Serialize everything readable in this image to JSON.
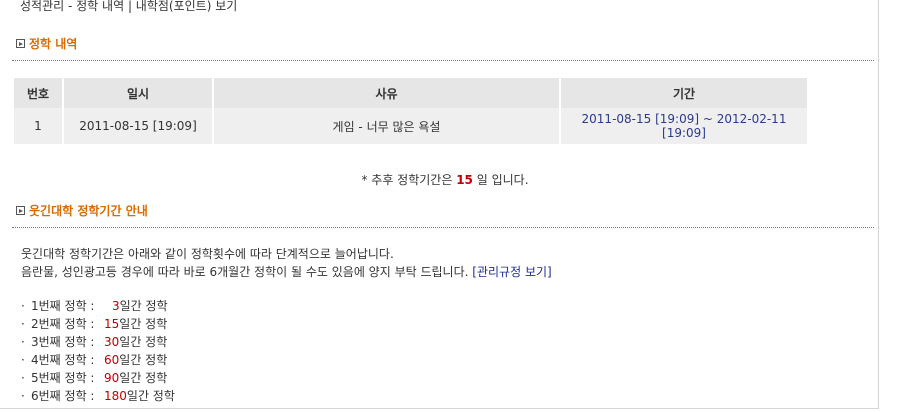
{
  "breadcrumb": {
    "section": "성적관리",
    "sep1": " - ",
    "current": "정학 내역",
    "sep2": " | ",
    "link": "내학점(포인트) 보기"
  },
  "history": {
    "title": "정학 내역",
    "columns": [
      "번호",
      "일시",
      "사유",
      "기간"
    ],
    "rows": [
      {
        "no": "1",
        "date": "2011-08-15 [19:09]",
        "reason": "게임 - 너무 많은 욕설",
        "period": "2011-08-15 [19:09] ~ 2012-02-11 [19:09]"
      }
    ],
    "note_prefix": "* 추후 정학기간은 ",
    "note_value": "15",
    "note_suffix": " 일 입니다."
  },
  "policy": {
    "title": "웃긴대학 정학기간 안내",
    "line1": "웃긴대학 정학기간은 아래와 같이 정학횟수에 따라 단계적으로 늘어납니다.",
    "line2": "음란물, 성인광고등 경우에 따라 바로 6개월간 정학이 될 수도 있음에 양지 부탁 드립니다.",
    "link": "[관리규정 보기]",
    "bullet": "·",
    "steps": [
      {
        "label": "1번째 정학 :",
        "days": "3",
        "unit": "일간 정학"
      },
      {
        "label": "2번째 정학 :",
        "days": "15",
        "unit": "일간 정학"
      },
      {
        "label": "3번째 정학 :",
        "days": "30",
        "unit": "일간 정학"
      },
      {
        "label": "4번째 정학 :",
        "days": "60",
        "unit": "일간 정학"
      },
      {
        "label": "5번째 정학 :",
        "days": "90",
        "unit": "일간 정학"
      },
      {
        "label": "6번째 정학 :",
        "days": "180",
        "unit": "일간 정학"
      }
    ]
  },
  "colors": {
    "section_title": "#d96b00",
    "highlight": "#c00000",
    "period_text": "#2b3a8c"
  }
}
